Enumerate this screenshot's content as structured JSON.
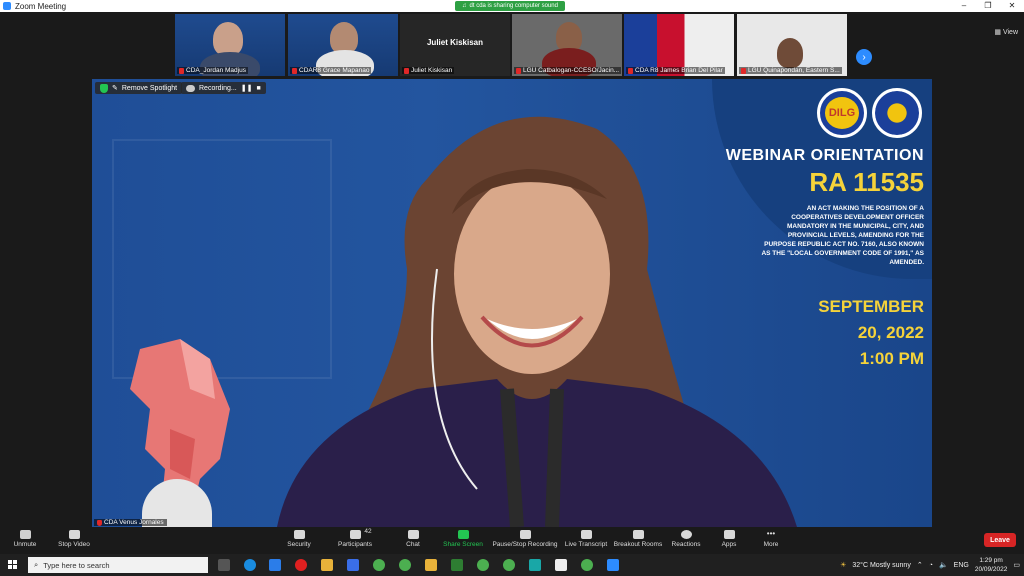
{
  "window": {
    "title": "Zoom Meeting"
  },
  "share_banner": {
    "text": "dt cda is sharing computer sound"
  },
  "view_button": {
    "label": "View"
  },
  "participants_strip": [
    {
      "name": "CDA_Jordan Madjus"
    },
    {
      "name": "CDAR8 Grace Mapanao"
    },
    {
      "name": "Juliet Kiskisan",
      "center_name": "Juliet Kiskisan"
    },
    {
      "name": "LGU Catbalogan-CCESO/Jacin..."
    },
    {
      "name": "CDA R8 James Brian Del Pilar"
    },
    {
      "name": "LGU Quinapondan, Eastern S..."
    }
  ],
  "spotlight": {
    "remove_label": "Remove Spotlight",
    "recording_label": "Recording..."
  },
  "slide": {
    "logo_left": "DILG",
    "heading": "WEBINAR ORIENTATION",
    "subheading": "RA 11535",
    "description": "AN ACT MAKING THE POSITION OF A COOPERATIVES DEVELOPMENT OFFICER MANDATORY IN THE MUNICIPAL, CITY, AND PROVINCIAL LEVELS, AMENDING FOR THE PURPOSE REPUBLIC ACT NO. 7160, ALSO KNOWN AS THE \"LOCAL GOVERNMENT CODE OF 1991,\" AS AMENDED.",
    "date_line1": "SEPTEMBER",
    "date_line2": "20, 2022",
    "time": "1:00 PM"
  },
  "speaker": {
    "name": "CDA Venus Jornales"
  },
  "toolbar": {
    "unmute": "Unmute",
    "stop_video": "Stop Video",
    "security": "Security",
    "participants": "Participants",
    "participants_count": "42",
    "chat": "Chat",
    "share_screen": "Share Screen",
    "pause_recording": "Pause/Stop Recording",
    "live_transcript": "Live Transcript",
    "breakout_rooms": "Breakout Rooms",
    "reactions": "Reactions",
    "apps": "Apps",
    "more": "More",
    "leave": "Leave"
  },
  "taskbar": {
    "search_placeholder": "Type here to search",
    "weather": "32°C  Mostly sunny",
    "language": "ENG",
    "time": "1:29 pm",
    "date": "20/09/2022"
  }
}
